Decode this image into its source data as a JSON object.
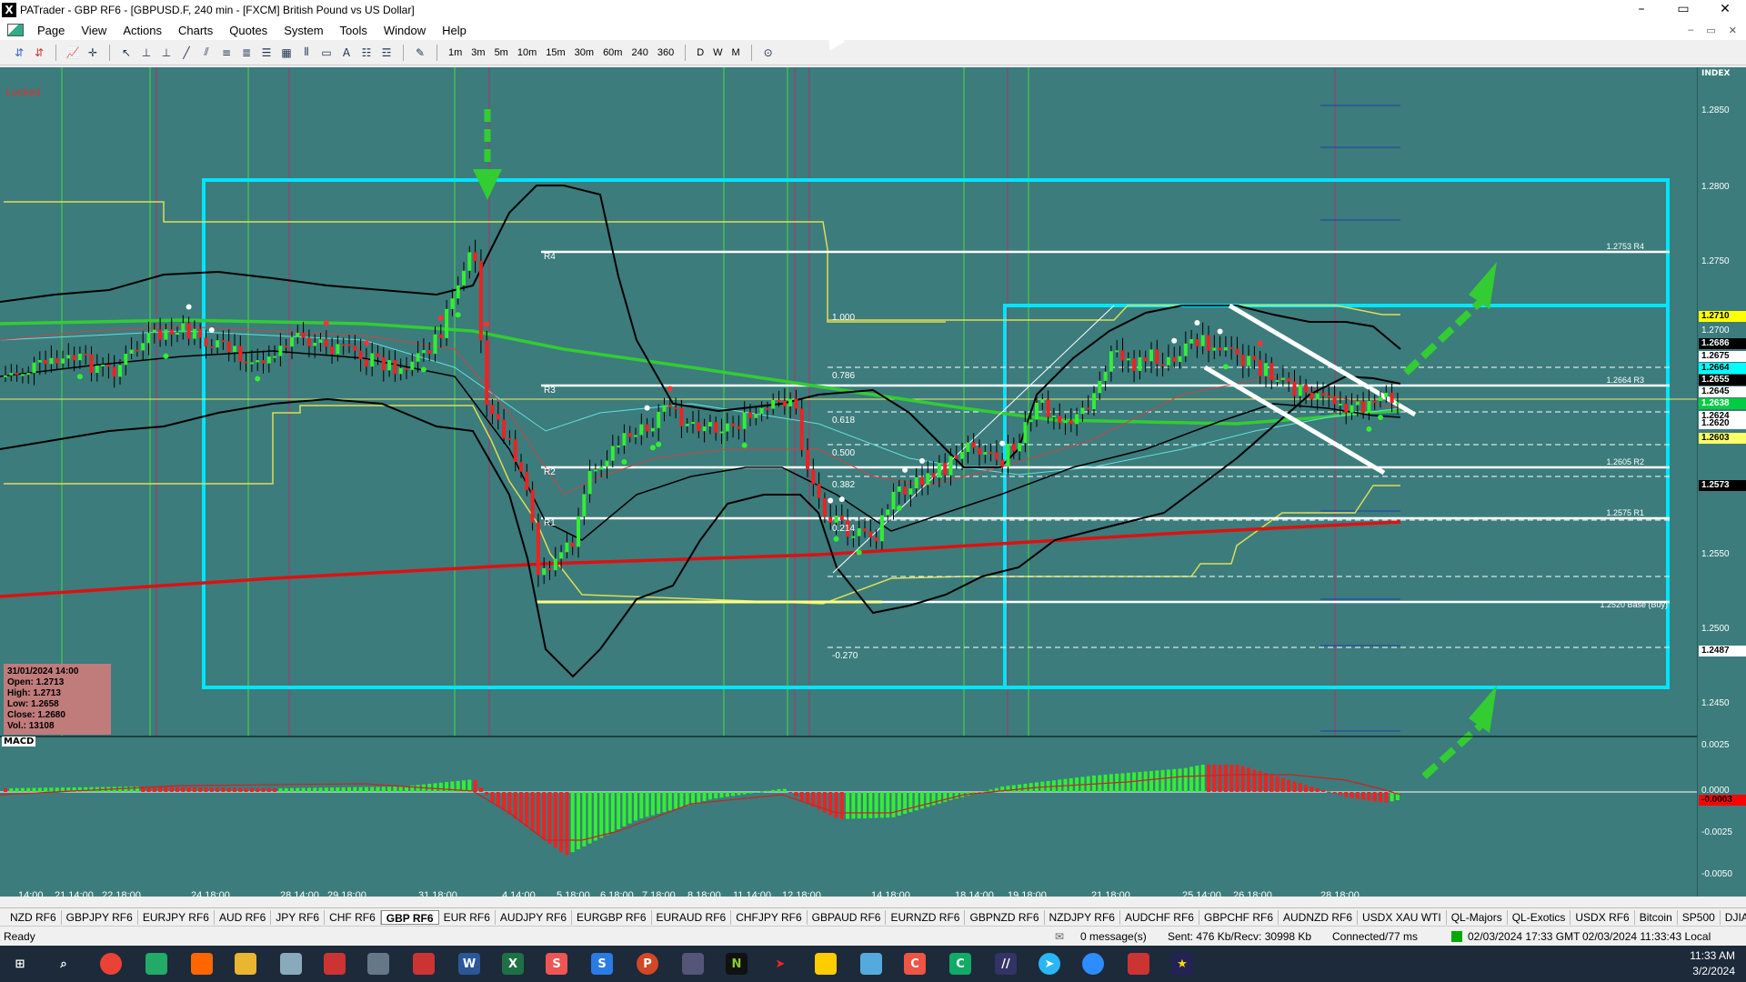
{
  "window": {
    "title": "PATrader - GBP RF6 - [GBPUSD.F, 240 min - [FXCM] British Pound vs US Dollar]",
    "app_icon": "X",
    "min": "–",
    "max": "▭",
    "close": "✕"
  },
  "menu": {
    "items": [
      "Page",
      "View",
      "Actions",
      "Charts",
      "Quotes",
      "System",
      "Tools",
      "Window",
      "Help"
    ],
    "mdi": [
      "–",
      "▭",
      "✕"
    ]
  },
  "toolbar": {
    "timeframes": [
      "1m",
      "3m",
      "5m",
      "10m",
      "15m",
      "30m",
      "60m",
      "240",
      "360"
    ],
    "periods": [
      "D",
      "W",
      "M"
    ]
  },
  "chart": {
    "locked_label": "Locked",
    "index_tag": "INDEX",
    "ohlc": {
      "date": "31/01/2024 14:00",
      "open": "Open: 1.2713",
      "high": "High: 1.2713",
      "low": "Low: 1.2658",
      "close": "Close: 1.2680",
      "vol": "Vol.: 13108"
    },
    "macd_label": "MACD",
    "fib_labels": [
      "1.000",
      "0.786",
      "0.618",
      "0.500",
      "0.382",
      "0.214",
      "-0.270"
    ],
    "pivot_labels": [
      "R4",
      "R3",
      "R2",
      "R1"
    ],
    "right_pivot_labels": [
      "1.2753 R4",
      "1.2664 R3",
      "1.2605 R2",
      "1.2575 R1",
      "1.2520 Base (Buy)"
    ],
    "price_ticks": [
      "1.2850",
      "1.2800",
      "1.2750",
      "1.2700",
      "1.2650",
      "1.2600",
      "1.2550",
      "1.2500",
      "1.2450"
    ],
    "price_tags": [
      {
        "text": "1.2710",
        "bg": "#ffff00",
        "fg": "#000"
      },
      {
        "text": "1.2686",
        "bg": "#000",
        "fg": "#fff"
      },
      {
        "text": "1.2675",
        "bg": "#fff",
        "fg": "#000"
      },
      {
        "text": "1.2664",
        "bg": "#00ffff",
        "fg": "#000"
      },
      {
        "text": "1.2655",
        "bg": "#000",
        "fg": "#fff"
      },
      {
        "text": "1.2645",
        "bg": "#fff",
        "fg": "#000"
      },
      {
        "text": "1.2638",
        "bg": "#00cc44",
        "fg": "#fff"
      },
      {
        "text": "1.2624",
        "bg": "#fff",
        "fg": "#000"
      },
      {
        "text": "1.2620",
        "bg": "#fff",
        "fg": "#000"
      },
      {
        "text": "1.2603",
        "bg": "#ffff66",
        "fg": "#000"
      },
      {
        "text": "1.2573",
        "bg": "#000",
        "fg": "#fff"
      },
      {
        "text": "1.2487",
        "bg": "#fff",
        "fg": "#000"
      }
    ],
    "macd_ticks": [
      "0.0025",
      "0.0000",
      "-0.0025",
      "-0.0050"
    ],
    "macd_value": {
      "text": "-0.0003",
      "bg": "#ff0000"
    },
    "time_labels": [
      "14:00",
      "21 14:00",
      "22 18:00",
      "24 18:00",
      "28 14:00",
      "29 18:00",
      "31 18:00",
      "4 14:00",
      "5 18:00",
      "6 18:00",
      "7 18:00",
      "8 18:00",
      "11 14:00",
      "12 18:00",
      "14 18:00",
      "18 14:00",
      "19 18:00",
      "21 18:00",
      "25 14:00",
      "26 18:00",
      "28 18:00"
    ],
    "colors": {
      "background": "#3c7c7c",
      "bull": "#33ee33",
      "bear": "#ee2222",
      "box": "#00e5ff",
      "ma_long": "#dd1111",
      "ma_mid": "#33cc33",
      "bands": "#000000",
      "pivot": "#ffffff",
      "fib": "#e0e070"
    }
  },
  "tabs": {
    "items": [
      "NZD RF6",
      "GBPJPY RF6",
      "EURJPY RF6",
      "AUD RF6",
      "JPY RF6",
      "CHF RF6",
      "GBP RF6",
      "EUR RF6",
      "AUDJPY RF6",
      "EURGBP RF6",
      "EURAUD RF6",
      "CHFJPY RF6",
      "GBPAUD RF6",
      "EURNZD RF6",
      "GBPNZD RF6",
      "NZDJPY RF6",
      "AUDCHF RF6",
      "GBPCHF RF6",
      "AUDNZD RF6",
      "USDX XAU WTI",
      "QL-Majors",
      "QL-Exotics",
      "USDX RF6",
      "Bitcoin",
      "SP500",
      "DJIA"
    ],
    "active": "GBP RF6"
  },
  "status": {
    "ready": "Ready",
    "messages": "0 message(s)",
    "traffic": "Sent: 476 Kb/Recv: 30998 Kb",
    "connection": "Connected/77 ms",
    "gmt": "02/03/2024 17:33 GMT",
    "local": "02/03/2024 11:33:43 Local"
  },
  "taskbar": {
    "time": "11:33 AM",
    "date": "3/2/2024"
  }
}
